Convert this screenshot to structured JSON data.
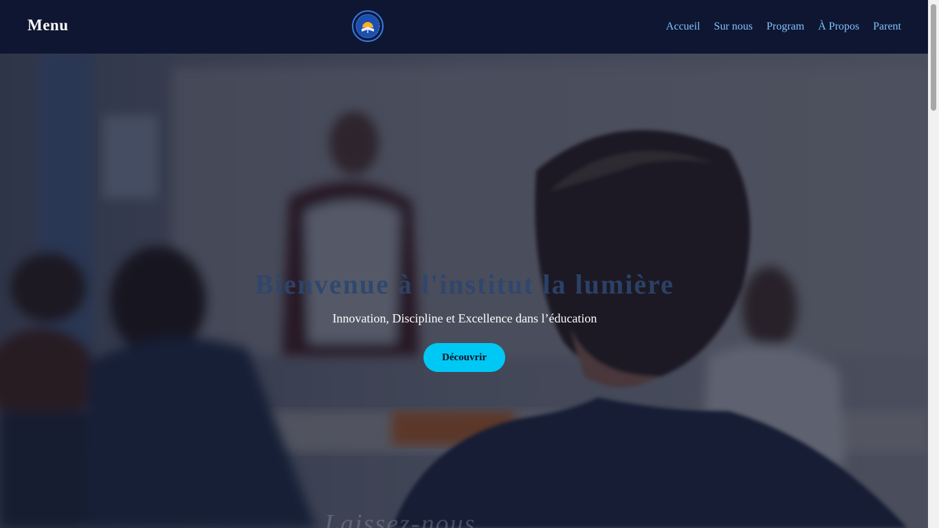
{
  "navbar": {
    "brand": "Menu",
    "logo": "school-logo-icon",
    "links": [
      "Accueil",
      "Sur nous",
      "Program",
      "À Propos",
      "Parent"
    ]
  },
  "hero": {
    "title": "Bienvenue à l'institut la lumière",
    "subtitle": "Innovation, Discipline et Excellence dans l’éducation",
    "button_label": "Découvrir",
    "next_section_partial": "Laissez-nous"
  },
  "colors": {
    "navbar_bg": "#0f1631",
    "nav_link": "#7fc4ff",
    "button_bg": "#00c8f5",
    "title": "#2d466e",
    "subtitle": "#ffffff"
  }
}
